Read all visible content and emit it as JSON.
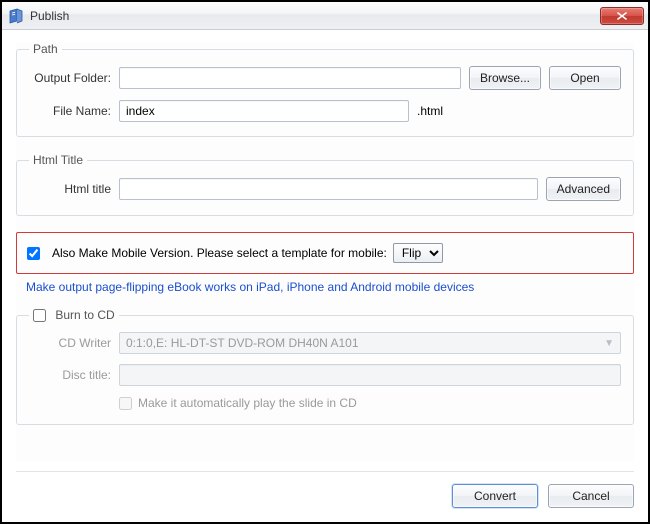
{
  "window": {
    "title": "Publish"
  },
  "path": {
    "legend": "Path",
    "output_folder_label": "Output Folder:",
    "output_folder_value": "",
    "browse_label": "Browse...",
    "open_label": "Open",
    "file_name_label": "File Name:",
    "file_name_value": "index",
    "file_ext": ".html"
  },
  "html_title": {
    "legend": "Html Title",
    "label": "Html title",
    "value": "",
    "advanced_label": "Advanced"
  },
  "mobile": {
    "checkbox_checked": true,
    "text": "Also Make Mobile Version. Please select a template for mobile:",
    "template_options": [
      "Flip"
    ],
    "template_selected": "Flip",
    "hint": "Make output page-flipping eBook works on iPad, iPhone and Android mobile devices"
  },
  "burn": {
    "legend": "Burn to CD",
    "checked": false,
    "writer_label": "CD Writer",
    "writer_value": "0:1:0,E: HL-DT-ST DVD-ROM DH40N    A101",
    "disc_title_label": "Disc title:",
    "disc_title_value": "",
    "autoplay_label": "Make it automatically play the slide in CD",
    "autoplay_checked": false
  },
  "footer": {
    "convert_label": "Convert",
    "cancel_label": "Cancel"
  }
}
